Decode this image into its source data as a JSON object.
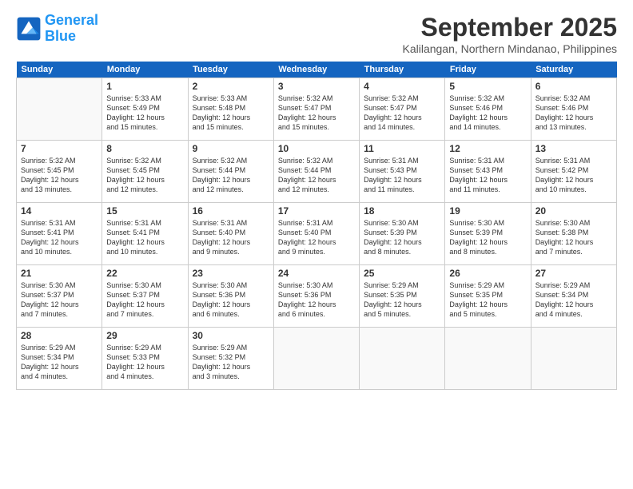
{
  "logo": {
    "line1": "General",
    "line2": "Blue"
  },
  "title": "September 2025",
  "location": "Kalilangan, Northern Mindanao, Philippines",
  "days_of_week": [
    "Sunday",
    "Monday",
    "Tuesday",
    "Wednesday",
    "Thursday",
    "Friday",
    "Saturday"
  ],
  "weeks": [
    [
      {
        "day": "",
        "info": ""
      },
      {
        "day": "1",
        "info": "Sunrise: 5:33 AM\nSunset: 5:49 PM\nDaylight: 12 hours\nand 15 minutes."
      },
      {
        "day": "2",
        "info": "Sunrise: 5:33 AM\nSunset: 5:48 PM\nDaylight: 12 hours\nand 15 minutes."
      },
      {
        "day": "3",
        "info": "Sunrise: 5:32 AM\nSunset: 5:47 PM\nDaylight: 12 hours\nand 15 minutes."
      },
      {
        "day": "4",
        "info": "Sunrise: 5:32 AM\nSunset: 5:47 PM\nDaylight: 12 hours\nand 14 minutes."
      },
      {
        "day": "5",
        "info": "Sunrise: 5:32 AM\nSunset: 5:46 PM\nDaylight: 12 hours\nand 14 minutes."
      },
      {
        "day": "6",
        "info": "Sunrise: 5:32 AM\nSunset: 5:46 PM\nDaylight: 12 hours\nand 13 minutes."
      }
    ],
    [
      {
        "day": "7",
        "info": "Sunrise: 5:32 AM\nSunset: 5:45 PM\nDaylight: 12 hours\nand 13 minutes."
      },
      {
        "day": "8",
        "info": "Sunrise: 5:32 AM\nSunset: 5:45 PM\nDaylight: 12 hours\nand 12 minutes."
      },
      {
        "day": "9",
        "info": "Sunrise: 5:32 AM\nSunset: 5:44 PM\nDaylight: 12 hours\nand 12 minutes."
      },
      {
        "day": "10",
        "info": "Sunrise: 5:32 AM\nSunset: 5:44 PM\nDaylight: 12 hours\nand 12 minutes."
      },
      {
        "day": "11",
        "info": "Sunrise: 5:31 AM\nSunset: 5:43 PM\nDaylight: 12 hours\nand 11 minutes."
      },
      {
        "day": "12",
        "info": "Sunrise: 5:31 AM\nSunset: 5:43 PM\nDaylight: 12 hours\nand 11 minutes."
      },
      {
        "day": "13",
        "info": "Sunrise: 5:31 AM\nSunset: 5:42 PM\nDaylight: 12 hours\nand 10 minutes."
      }
    ],
    [
      {
        "day": "14",
        "info": "Sunrise: 5:31 AM\nSunset: 5:41 PM\nDaylight: 12 hours\nand 10 minutes."
      },
      {
        "day": "15",
        "info": "Sunrise: 5:31 AM\nSunset: 5:41 PM\nDaylight: 12 hours\nand 10 minutes."
      },
      {
        "day": "16",
        "info": "Sunrise: 5:31 AM\nSunset: 5:40 PM\nDaylight: 12 hours\nand 9 minutes."
      },
      {
        "day": "17",
        "info": "Sunrise: 5:31 AM\nSunset: 5:40 PM\nDaylight: 12 hours\nand 9 minutes."
      },
      {
        "day": "18",
        "info": "Sunrise: 5:30 AM\nSunset: 5:39 PM\nDaylight: 12 hours\nand 8 minutes."
      },
      {
        "day": "19",
        "info": "Sunrise: 5:30 AM\nSunset: 5:39 PM\nDaylight: 12 hours\nand 8 minutes."
      },
      {
        "day": "20",
        "info": "Sunrise: 5:30 AM\nSunset: 5:38 PM\nDaylight: 12 hours\nand 7 minutes."
      }
    ],
    [
      {
        "day": "21",
        "info": "Sunrise: 5:30 AM\nSunset: 5:37 PM\nDaylight: 12 hours\nand 7 minutes."
      },
      {
        "day": "22",
        "info": "Sunrise: 5:30 AM\nSunset: 5:37 PM\nDaylight: 12 hours\nand 7 minutes."
      },
      {
        "day": "23",
        "info": "Sunrise: 5:30 AM\nSunset: 5:36 PM\nDaylight: 12 hours\nand 6 minutes."
      },
      {
        "day": "24",
        "info": "Sunrise: 5:30 AM\nSunset: 5:36 PM\nDaylight: 12 hours\nand 6 minutes."
      },
      {
        "day": "25",
        "info": "Sunrise: 5:29 AM\nSunset: 5:35 PM\nDaylight: 12 hours\nand 5 minutes."
      },
      {
        "day": "26",
        "info": "Sunrise: 5:29 AM\nSunset: 5:35 PM\nDaylight: 12 hours\nand 5 minutes."
      },
      {
        "day": "27",
        "info": "Sunrise: 5:29 AM\nSunset: 5:34 PM\nDaylight: 12 hours\nand 4 minutes."
      }
    ],
    [
      {
        "day": "28",
        "info": "Sunrise: 5:29 AM\nSunset: 5:34 PM\nDaylight: 12 hours\nand 4 minutes."
      },
      {
        "day": "29",
        "info": "Sunrise: 5:29 AM\nSunset: 5:33 PM\nDaylight: 12 hours\nand 4 minutes."
      },
      {
        "day": "30",
        "info": "Sunrise: 5:29 AM\nSunset: 5:32 PM\nDaylight: 12 hours\nand 3 minutes."
      },
      {
        "day": "",
        "info": ""
      },
      {
        "day": "",
        "info": ""
      },
      {
        "day": "",
        "info": ""
      },
      {
        "day": "",
        "info": ""
      }
    ]
  ]
}
